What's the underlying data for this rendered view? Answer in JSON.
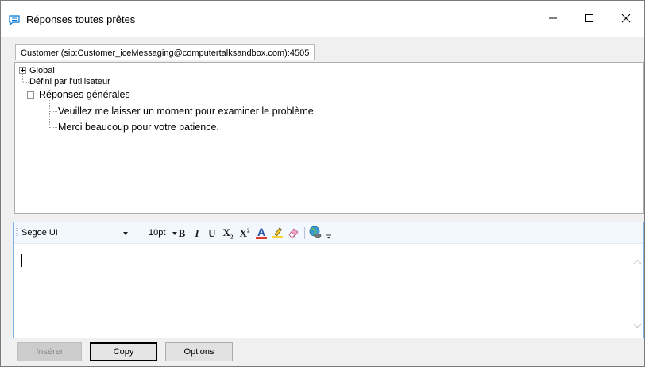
{
  "window": {
    "title": "Réponses toutes prêtes",
    "icon": "chat-bubble-icon",
    "controls": [
      "minimize-icon",
      "maximize-icon",
      "close-icon"
    ]
  },
  "tabs": [
    {
      "label": "Customer (sip:Customer_iceMessaging@computertalksandbox.com):4505",
      "selected": true
    }
  ],
  "tree": {
    "nodes": [
      {
        "label": "Global",
        "expanded": false
      },
      {
        "label": "Défini par l'utilisateur"
      },
      {
        "label": "Réponses générales",
        "expanded": true,
        "children": [
          {
            "label": "Veuillez me laisser un moment pour examiner le problème."
          },
          {
            "label": "Merci beaucoup pour votre patience."
          }
        ]
      }
    ]
  },
  "editor": {
    "font": "Segoe UI",
    "size": "10pt",
    "toolbar_icons": [
      "bold-icon",
      "italic-icon",
      "underline-icon",
      "subscript-icon",
      "superscript-icon",
      "font-color-icon",
      "highlight-icon",
      "eraser-icon",
      "insert-link-icon",
      "overflow-icon"
    ],
    "bold_glyph": "B",
    "italic_glyph": "I",
    "underline_glyph": "U",
    "subscript_glyph": "X",
    "superscript_glyph": "X",
    "subscript_mark": "2",
    "superscript_mark": "2",
    "font_color_glyph": "A",
    "font_color": "#e03a2e",
    "content": ""
  },
  "buttons": {
    "insert": "Insérer",
    "copy": "Copy",
    "options": "Options"
  },
  "colors": {
    "accent": "#0078d7",
    "editor_border": "#7fb2e0",
    "toolbar_bg": "#f3f8fe"
  }
}
